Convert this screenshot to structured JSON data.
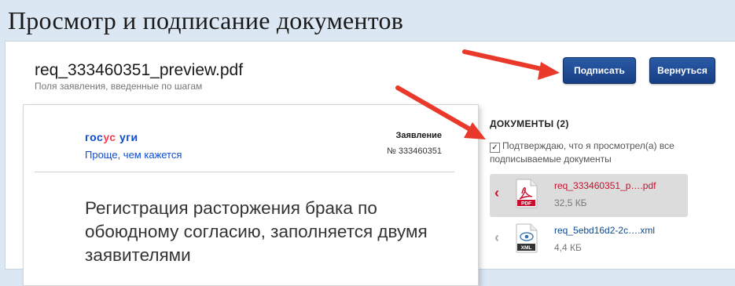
{
  "page": {
    "title": "Просмотр и подписание документов"
  },
  "document": {
    "filename": "req_333460351_preview.pdf",
    "subtitle": "Поля заявления, введенные по шагам"
  },
  "actions": {
    "sign_label": "Подписать",
    "back_label": "Вернуться"
  },
  "preview": {
    "logo_part1": "гос",
    "logo_part2": "ус",
    "logo_part3": "уги",
    "slogan": "Проще, чем кажется",
    "application_label": "Заявление",
    "application_number": "№ 333460351",
    "heading": "Регистрация расторжения брака по обоюдному согласию, заполняется двумя заявителями"
  },
  "documents_panel": {
    "title": "ДОКУМЕНТЫ (2)",
    "confirm_label": "Подтверждаю, что я просмотрел(а) все подписываемые документы",
    "confirm_checked": true,
    "files": [
      {
        "name": "req_333460351_p….pdf",
        "size": "32,5 КБ",
        "icon": "pdf-file-icon",
        "icon_text": "PDF",
        "active": true
      },
      {
        "name": "req_5ebd16d2-2c….xml",
        "size": "4,4 КБ",
        "icon": "xml-file-icon",
        "icon_text": "XML",
        "active": false
      }
    ]
  },
  "colors": {
    "accent_red": "#c8102e",
    "button_blue": "#1e4b96",
    "link_blue": "#0d4a8f",
    "gosuslugi_blue": "#0d4cd3",
    "gosuslugi_red": "#ee3f58",
    "annotation_arrow": "#e8392b"
  }
}
